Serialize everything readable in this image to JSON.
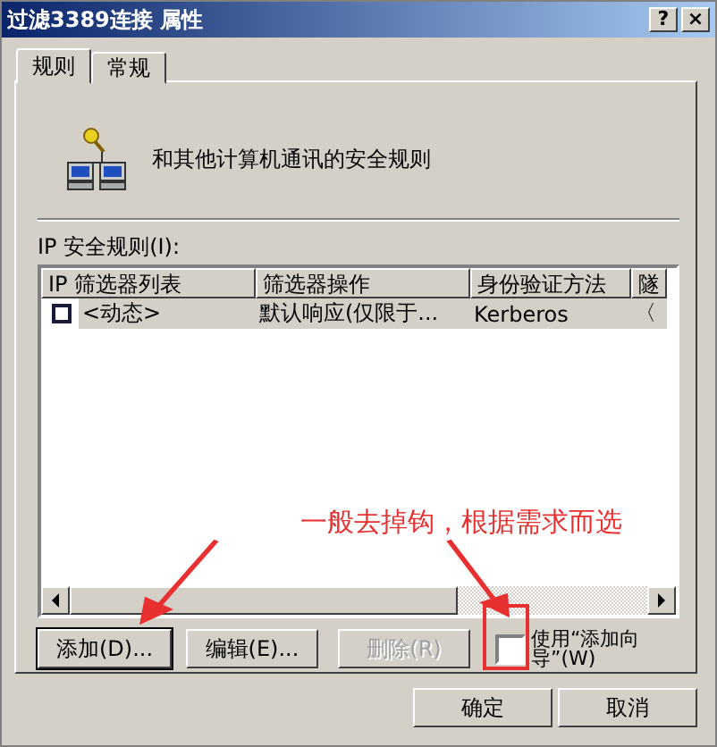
{
  "window": {
    "title": "过滤3389连接 属性",
    "buttons": [
      "?",
      "×"
    ]
  },
  "tabs": [
    {
      "label": "规则",
      "selected": true
    },
    {
      "label": "常规",
      "selected": false
    }
  ],
  "header": {
    "text": "和其他计算机通讯的安全规则"
  },
  "rules": {
    "label": "IP 安全规则(I):",
    "columns": [
      "IP 筛选器列表",
      "筛选器操作",
      "身份验证方法",
      "隧"
    ],
    "rows": [
      {
        "checked": false,
        "selected": true,
        "cells": [
          "<动态>",
          "默认响应(仅限于...",
          "Kerberos",
          "〈"
        ]
      }
    ]
  },
  "actions": [
    {
      "label": "添加(D)...",
      "disabled": false
    },
    {
      "label": "编辑(E)...",
      "disabled": false
    },
    {
      "label": "删除(R)",
      "disabled": true
    }
  ],
  "wizard": {
    "label": "使用“添加向导”(W)",
    "checked": false
  },
  "annotation": {
    "text": "一般去掉钩，根据需求而选"
  },
  "footer": {
    "buttons": [
      "确定",
      "取消"
    ]
  }
}
